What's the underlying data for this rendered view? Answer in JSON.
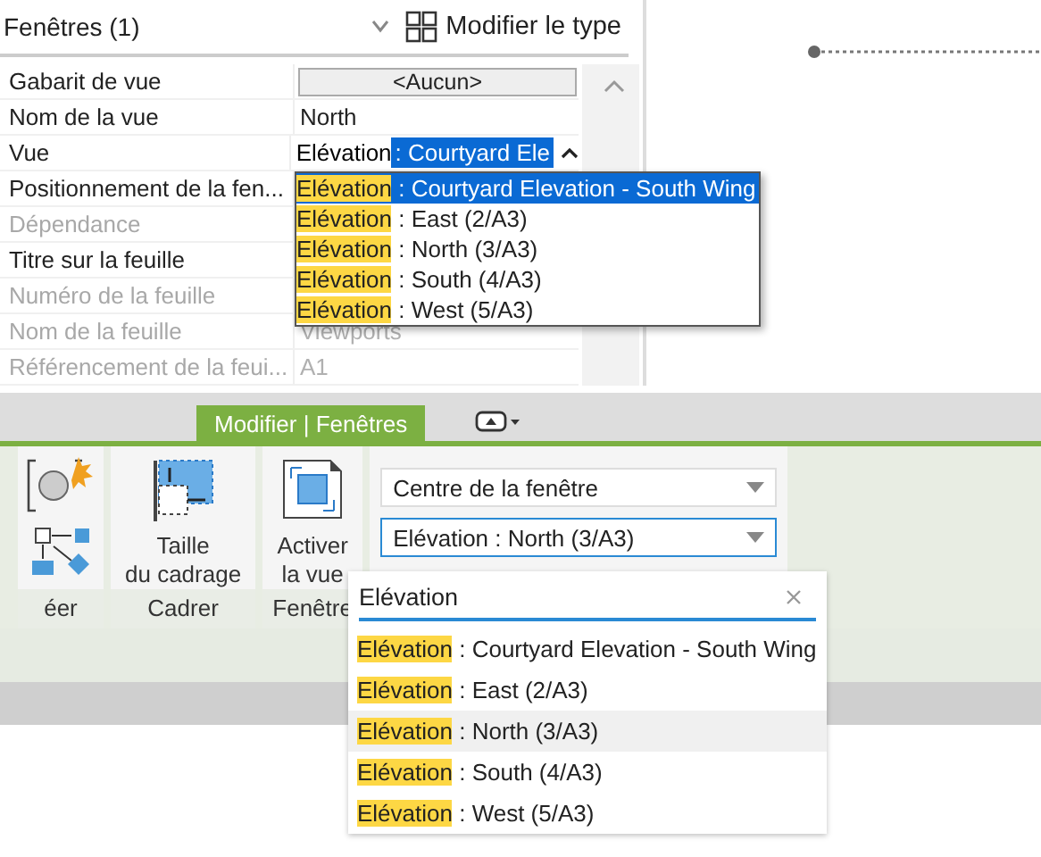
{
  "properties": {
    "header": {
      "title": "Fenêtres (1)",
      "edit_type": "Modifier le type"
    },
    "rows": [
      {
        "label": "Gabarit de vue",
        "value": "<Aucun>",
        "kind": "button",
        "disabled": false
      },
      {
        "label": "Nom de la vue",
        "value": "North",
        "kind": "text",
        "disabled": false
      },
      {
        "label": "Vue",
        "value": "Elévation",
        "selection": ": Courtyard Ele",
        "kind": "combo",
        "disabled": false
      },
      {
        "label": "Positionnement de la fen...",
        "kind": "text",
        "disabled": false
      },
      {
        "label": "Dépendance",
        "kind": "text",
        "disabled": true
      },
      {
        "label": "Titre sur la feuille",
        "kind": "text",
        "disabled": false
      },
      {
        "label": "Numéro de la feuille",
        "kind": "text",
        "disabled": true
      },
      {
        "label": "Nom de la feuille",
        "value": "Viewports",
        "kind": "text",
        "disabled": true
      },
      {
        "label": "Référencement de la feui...",
        "value": "A1",
        "kind": "text",
        "disabled": true
      }
    ],
    "dropdown": [
      {
        "match": "Elévation",
        "text": " : Courtyard Elevation - South Wing",
        "selected": true
      },
      {
        "match": "Elévation",
        "text": " : East (2/A3)",
        "selected": false
      },
      {
        "match": "Elévation",
        "text": " : North (3/A3)",
        "selected": false
      },
      {
        "match": "Elévation",
        "text": " : South (4/A3)",
        "selected": false
      },
      {
        "match": "Elévation",
        "text": " : West (5/A3)",
        "selected": false
      }
    ]
  },
  "ribbon": {
    "tabs": [
      {
        "label": "Modifier | Fenêtres",
        "selected": true
      }
    ],
    "panels": [
      {
        "label": "éer"
      },
      {
        "label": "Cadrer",
        "buttons": [
          "Taille\ndu cadrage"
        ]
      },
      {
        "label": "Fenêtre",
        "buttons": [
          "Activer\nla vue"
        ]
      }
    ],
    "position_combo": "Centre de la fenêtre",
    "view_combo": "Elévation : North (3/A3)",
    "search": {
      "value": "Elévation"
    },
    "options": [
      {
        "match": "Elévation",
        "text": " : Courtyard Elevation - South Wing",
        "selected": false
      },
      {
        "match": "Elévation",
        "text": " : East (2/A3)",
        "selected": false
      },
      {
        "match": "Elévation",
        "text": " : North (3/A3)",
        "selected": true
      },
      {
        "match": "Elévation",
        "text": " : South (4/A3)",
        "selected": false
      },
      {
        "match": "Elévation",
        "text": " : West (5/A3)",
        "selected": false
      }
    ]
  }
}
